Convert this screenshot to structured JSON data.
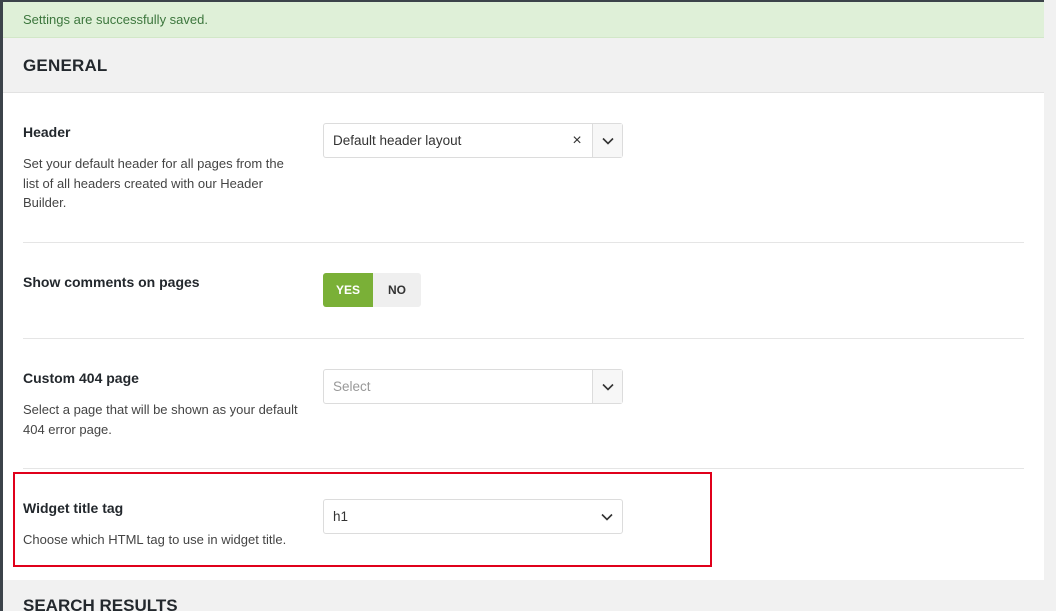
{
  "notice": {
    "text": "Settings are successfully saved."
  },
  "sections": {
    "general_title": "GENERAL",
    "search_title": "SEARCH RESULTS"
  },
  "header_setting": {
    "label": "Header",
    "description": "Set your default header for all pages from the list of all headers created with our Header Builder.",
    "value": "Default header layout",
    "clear_glyph": "×"
  },
  "comments_setting": {
    "label": "Show comments on pages",
    "yes_label": "YES",
    "no_label": "NO",
    "selected": "YES"
  },
  "page404_setting": {
    "label": "Custom 404 page",
    "description": "Select a page that will be shown as your default 404 error page.",
    "placeholder": "Select"
  },
  "widget_title_setting": {
    "label": "Widget title tag",
    "description": "Choose which HTML tag to use in widget title.",
    "value": "h1"
  },
  "colors": {
    "accent_green": "#7ab037",
    "notice_bg": "#dff0d8",
    "highlight_border": "#e0001b"
  },
  "icons": {
    "dropdown": "chevron-down-icon",
    "clear": "close-icon"
  }
}
